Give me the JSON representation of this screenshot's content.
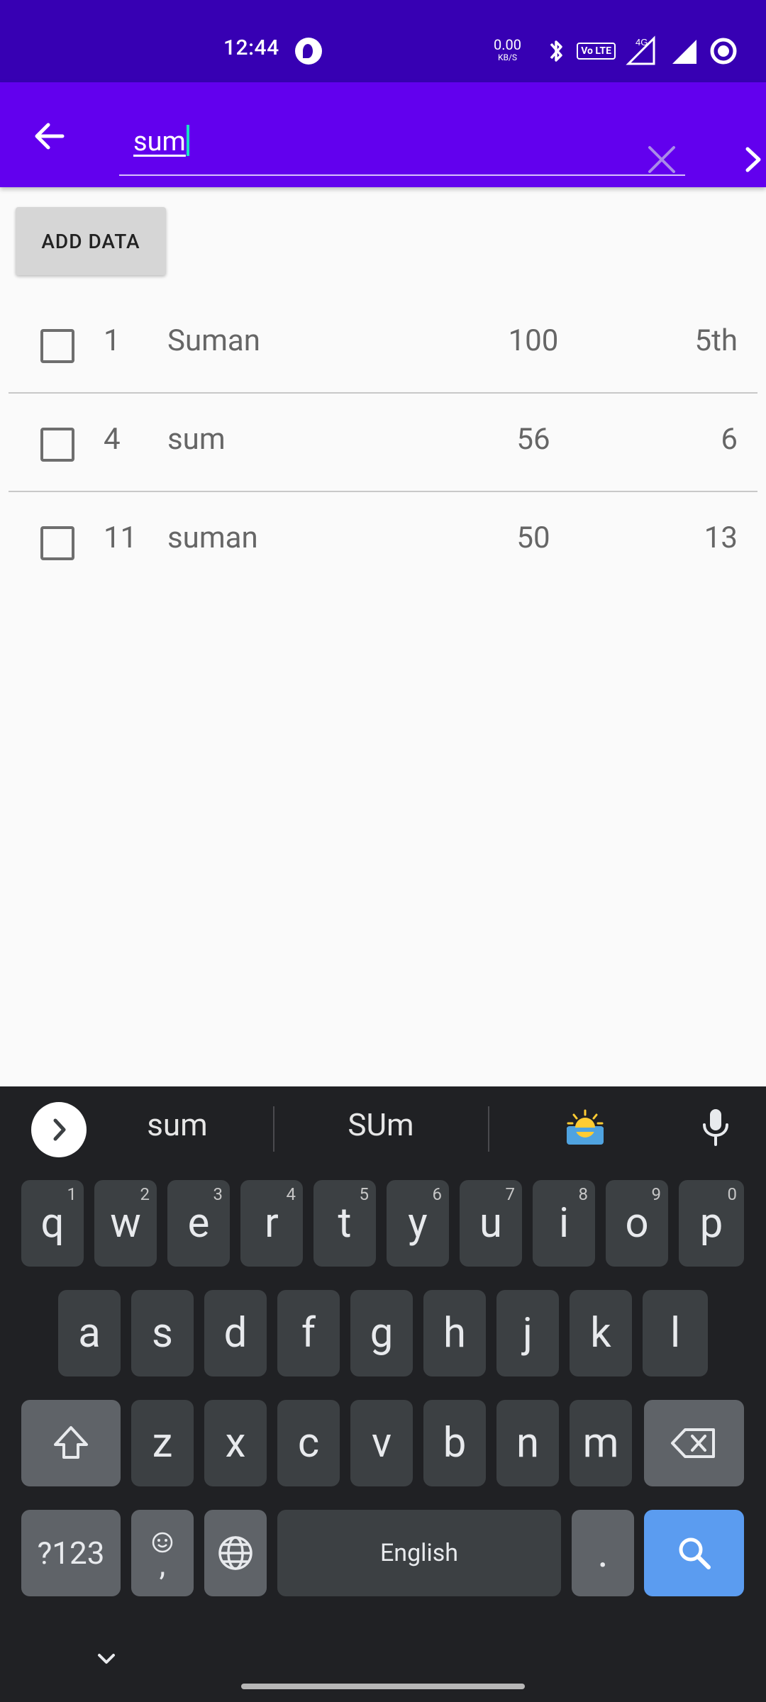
{
  "status_bar": {
    "time": "12:44",
    "net_speed": "0.00",
    "net_unit": "KB/S",
    "network_type": "4G",
    "volte": "Vo LTE"
  },
  "app_bar": {
    "search_value": "sum"
  },
  "actions": {
    "add_data_label": "ADD DATA"
  },
  "rows": [
    {
      "id": "1",
      "name": "Suman",
      "score": "100",
      "class": "5th"
    },
    {
      "id": "4",
      "name": "sum",
      "score": "56",
      "class": "6"
    },
    {
      "id": "11",
      "name": "suman",
      "score": "50",
      "class": "13"
    }
  ],
  "keyboard": {
    "suggestions": [
      "sum",
      "SUm"
    ],
    "row1": [
      [
        "q",
        "1"
      ],
      [
        "w",
        "2"
      ],
      [
        "e",
        "3"
      ],
      [
        "r",
        "4"
      ],
      [
        "t",
        "5"
      ],
      [
        "y",
        "6"
      ],
      [
        "u",
        "7"
      ],
      [
        "i",
        "8"
      ],
      [
        "o",
        "9"
      ],
      [
        "p",
        "0"
      ]
    ],
    "row2": [
      "a",
      "s",
      "d",
      "f",
      "g",
      "h",
      "j",
      "k",
      "l"
    ],
    "row3": [
      "z",
      "x",
      "c",
      "v",
      "b",
      "n",
      "m"
    ],
    "symbols_label": "?123",
    "comma_label": ",",
    "space_label": "English",
    "period_label": "."
  },
  "colors": {
    "status_bar": "#3700b3",
    "app_bar": "#6200ee",
    "accent_caret": "#18e1c6",
    "search_key": "#5b9cf0"
  }
}
